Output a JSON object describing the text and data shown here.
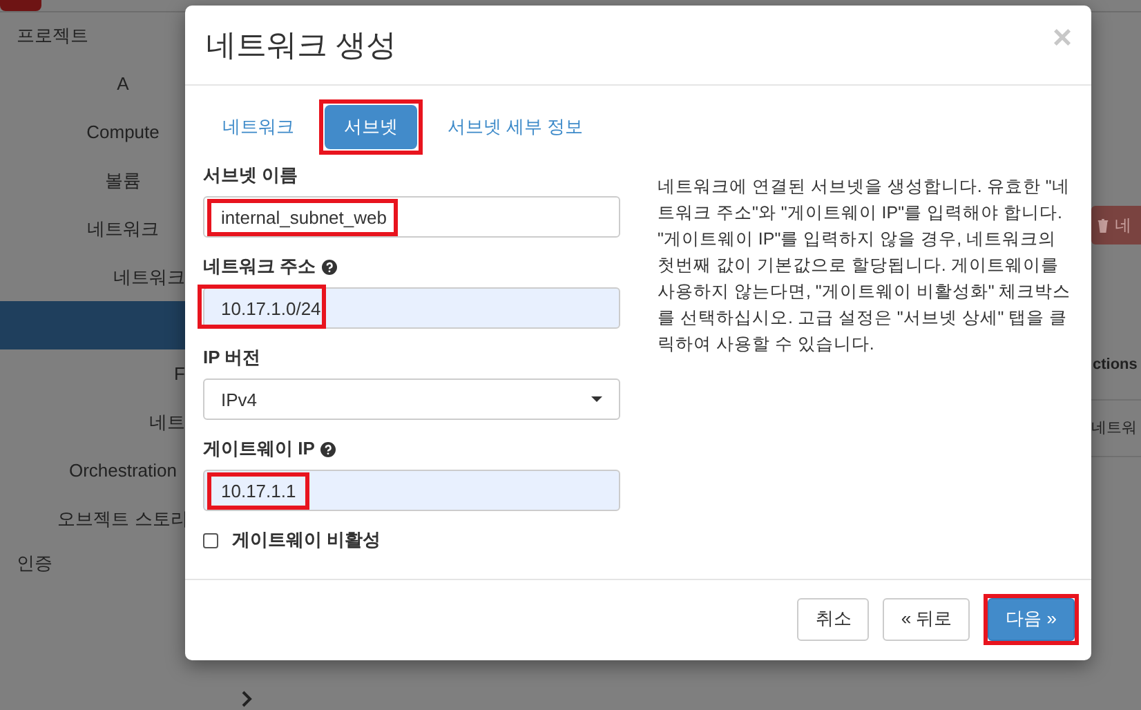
{
  "sidebar": [
    {
      "label": "프로젝트",
      "selected": false,
      "children": [
        {
          "label": "A",
          "selected": false
        },
        {
          "label": "Compute",
          "selected": false
        },
        {
          "label": "볼륨",
          "selected": false
        },
        {
          "label": "네트워크",
          "selected": false,
          "children": [
            {
              "label": "네트워크",
              "selected": false
            },
            {
              "selected": true
            },
            {
              "label": "F",
              "selected": false
            },
            {
              "label": "네트",
              "selected": false
            }
          ]
        },
        {
          "label": "Orchestration",
          "selected": false
        },
        {
          "label": "오브젝트 스토리",
          "selected": false
        }
      ]
    },
    {
      "label": "인증",
      "selected": false
    }
  ],
  "main": {
    "delete_button": "네",
    "column_header": "ctions",
    "cell": "네트워"
  },
  "modal": {
    "title": "네트워크 생성",
    "close": "×",
    "tabs": [
      {
        "label": "네트워크",
        "selected": false,
        "highlighted": false
      },
      {
        "label": "서브넷",
        "selected": true,
        "highlighted": true
      },
      {
        "label": "서브넷 세부 정보",
        "selected": false,
        "highlighted": false
      }
    ],
    "fields": [
      {
        "kind": "text",
        "label": "서브넷 이름",
        "value": "internal_subnet_web",
        "help": false,
        "highlighted": true,
        "autofilled": false
      },
      {
        "kind": "text",
        "label": "네트워크 주소",
        "value": "10.17.1.0/24",
        "help": true,
        "highlighted": true,
        "autofilled": true
      },
      {
        "kind": "select",
        "label": "IP 버전",
        "value": "IPv4",
        "help": false,
        "highlighted": false,
        "autofilled": false
      },
      {
        "kind": "text",
        "label": "게이트웨이 IP",
        "value": "10.17.1.1",
        "help": true,
        "highlighted": true,
        "autofilled": true
      },
      {
        "kind": "checkbox",
        "label": "게이트웨이 비활성",
        "checked": false
      }
    ],
    "description": "네트워크에 연결된 서브넷을 생성합니다. 유효한 \"네트워크 주소\"와 \"게이트웨이 IP\"를 입력해야 합니다. \"게이트웨이 IP\"를 입력하지 않을 경우, 네트워크의 첫번째 값이 기본값으로 할당됩니다. 게이트웨이를 사용하지 않는다면, \"게이트웨이 비활성화\" 체크박스를 선택하십시오. 고급 설정은 \"서브넷 상세\" 탭을 클릭하여 사용할 수 있습니다.",
    "buttons": [
      {
        "label": "취소",
        "kind": "default",
        "highlighted": false
      },
      {
        "label": "« 뒤로",
        "kind": "default",
        "highlighted": false
      },
      {
        "label": "다음 »",
        "kind": "primary",
        "highlighted": true
      }
    ]
  }
}
